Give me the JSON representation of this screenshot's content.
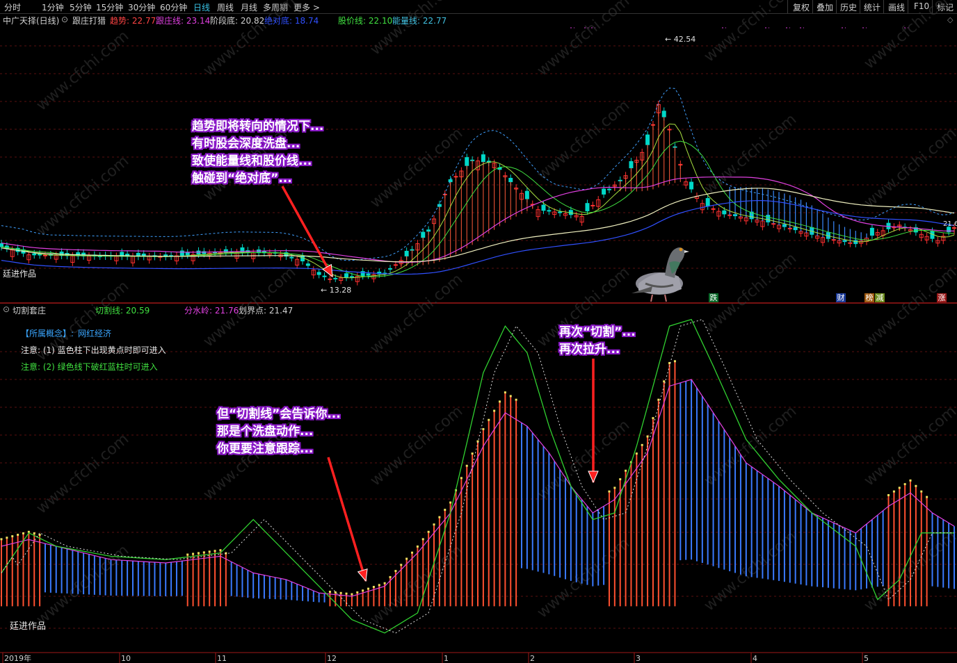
{
  "toolbar": {
    "tabs": [
      "分时",
      "1分钟",
      "5分钟",
      "15分钟",
      "30分钟",
      "60分钟",
      "日线",
      "周线",
      "月线",
      "多周期",
      "更多 >"
    ],
    "active_tab": "日线",
    "right_buttons": [
      "复权",
      "叠加",
      "历史",
      "统计",
      "画线",
      "F10",
      "标记"
    ]
  },
  "main_panel": {
    "stock_title": "中广天择(日线)",
    "indicator_name": "跟庄打猎",
    "indicators": [
      {
        "label": "趋势:",
        "value": "22.77",
        "color": "#ff4444"
      },
      {
        "label": "跟庄线:",
        "value": "23.14",
        "color": "#e040e0"
      },
      {
        "label": "阶段底:",
        "value": "20.82",
        "color": "#d0d0d0"
      },
      {
        "label": "绝对底:",
        "value": "18.74",
        "color": "#3050ff"
      },
      {
        "label": "股价线:",
        "value": "22.10",
        "color": "#40e040"
      },
      {
        "label": "能量线:",
        "value": "22.77",
        "color": "#40c0e0"
      }
    ],
    "high_label": "42.54",
    "low_label": "13.28",
    "right_edge_label": "21.6",
    "watermark_label": "廷进作品",
    "signal_markers": [
      "跌",
      "财",
      "榜",
      "减",
      "涨"
    ]
  },
  "sub_panel": {
    "indicator_name": "切割套庄",
    "indicators": [
      {
        "label": "切割线:",
        "value": "20.59",
        "color": "#40e040"
      },
      {
        "label": "分水岭:",
        "value": "21.76",
        "color": "#e040e0"
      },
      {
        "label": "划界点:",
        "value": "21.47",
        "color": "#d0d0d0"
      }
    ],
    "concept_label": "【所属概念】:",
    "concept_value": "网红经济",
    "note1": "注意: (1) 蓝色柱下出现黄点时即可进入",
    "note2": "注意: (2) 绿色线下破红蓝柱时可进入",
    "watermark_label": "廷进作品"
  },
  "callouts": {
    "c1": [
      "趋势即将转向的情况下...",
      "有时股会深度洗盘...",
      "致使能量线和股价线...",
      "触碰到“绝对底”..."
    ],
    "c2": [
      "但“切割线”会告诉你...",
      "那是个洗盘动作...",
      "你更要注意跟踪..."
    ],
    "c3": [
      "再次“切割”...",
      "再次拉升..."
    ]
  },
  "time_axis": [
    "2019年",
    "10",
    "11",
    "12",
    "1",
    "2",
    "3",
    "4",
    "5"
  ],
  "watermark": "www.cfchi.com"
}
